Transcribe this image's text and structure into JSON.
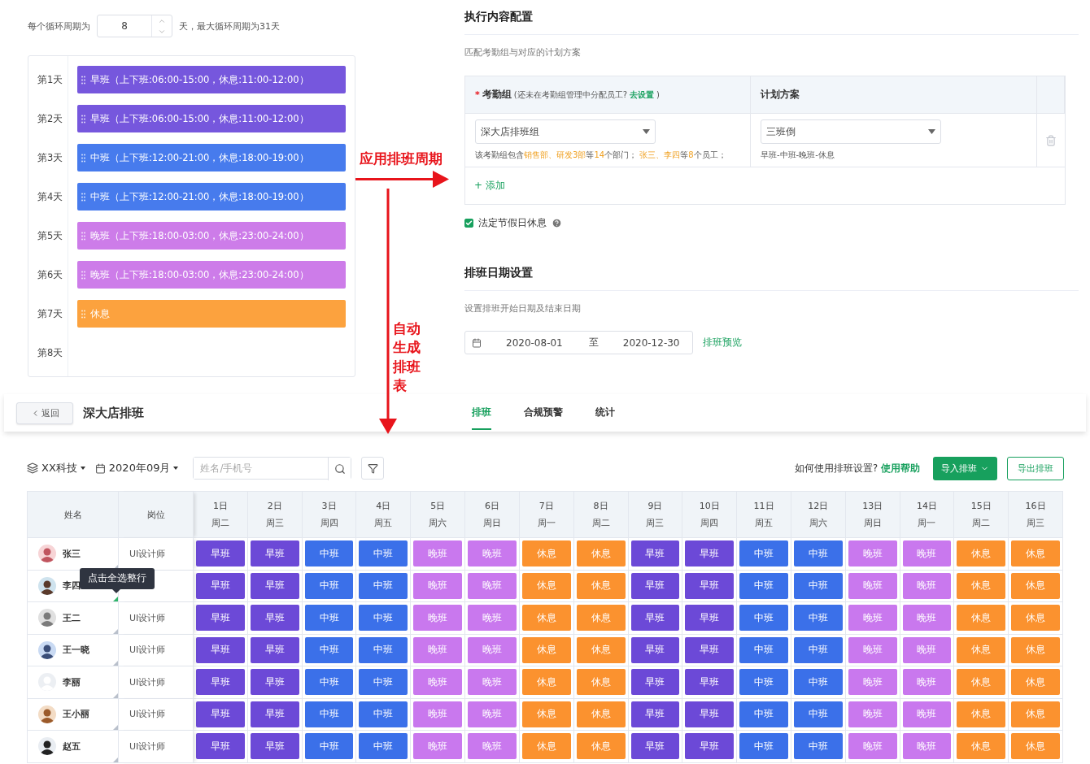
{
  "cycle": {
    "label": "每个循环周期为",
    "value": "8",
    "suffix": "天，最大循环周期为31天"
  },
  "cycle_days": [
    {
      "label": "第1天",
      "shift": {
        "kind": "early",
        "text": "早班（上下班:06:00-15:00，休息:11:00-12:00）"
      }
    },
    {
      "label": "第2天",
      "shift": {
        "kind": "early",
        "text": "早班（上下班:06:00-15:00，休息:11:00-12:00）"
      }
    },
    {
      "label": "第3天",
      "shift": {
        "kind": "mid",
        "text": "中班（上下班:12:00-21:00，休息:18:00-19:00）"
      }
    },
    {
      "label": "第4天",
      "shift": {
        "kind": "mid",
        "text": "中班（上下班:12:00-21:00，休息:18:00-19:00）"
      }
    },
    {
      "label": "第5天",
      "shift": {
        "kind": "late",
        "text": "晚班（上下班:18:00-03:00，休息:23:00-24:00）"
      }
    },
    {
      "label": "第6天",
      "shift": {
        "kind": "late",
        "text": "晚班（上下班:18:00-03:00，休息:23:00-24:00）"
      }
    },
    {
      "label": "第7天",
      "shift": {
        "kind": "rest",
        "text": "休息"
      }
    },
    {
      "label": "第8天"
    }
  ],
  "annotations": [
    {
      "kind": "horizontal",
      "text": "应用排班周期"
    },
    {
      "kind": "vertical",
      "text": "自动生成排班表"
    }
  ],
  "execution": {
    "title": "执行内容配置",
    "subtitle": "匹配考勤组与对应的计划方案",
    "group_header": {
      "required_mark": "*",
      "label": "考勤组",
      "hint": "(还未在考勤组管理中分配员工?",
      "link": "去设置",
      "hint_end": ")"
    },
    "plan_header": "计划方案",
    "rows": [
      {
        "group": "深大店排班组",
        "group_note": "该考勤组包含**销售部、研发3部**等**14**个部门；  **张三、李四**等**8**个员工；",
        "plan": "三班倒",
        "plan_note": "早班-中班-晚班-休息"
      }
    ],
    "add_link": "+ 添加",
    "holiday": {
      "label": "法定节假日休息",
      "checked": true
    }
  },
  "date_settings": {
    "title": "排班日期设置",
    "subtitle": "设置排班开始日期及结束日期",
    "start": "2020-08-01",
    "separator": "至",
    "end": "2020-12-30",
    "preview_link": "排班预览"
  },
  "header": {
    "back": "返回",
    "title": "深大店排班",
    "tabs": [
      {
        "label": "排班",
        "selected": true
      },
      {
        "label": "合规预警",
        "selected": false
      },
      {
        "label": "统计",
        "selected": false
      }
    ]
  },
  "toolbar": {
    "company": "XX科技",
    "month": "2020年09月",
    "search": {
      "placeholder": "姓名/手机号"
    },
    "help_text": "如何使用排班设置?",
    "help_link": "使用帮助",
    "import": "导入排班",
    "export": "导出排班"
  },
  "schedule": {
    "columns": {
      "name": "姓名",
      "role": "岗位"
    },
    "days": [
      {
        "date": "1日",
        "weekday": "周二"
      },
      {
        "date": "2日",
        "weekday": "周三"
      },
      {
        "date": "3日",
        "weekday": "周四"
      },
      {
        "date": "4日",
        "weekday": "周五"
      },
      {
        "date": "5日",
        "weekday": "周六"
      },
      {
        "date": "6日",
        "weekday": "周日"
      },
      {
        "date": "7日",
        "weekday": "周一"
      },
      {
        "date": "8日",
        "weekday": "周二"
      },
      {
        "date": "9日",
        "weekday": "周三"
      },
      {
        "date": "10日",
        "weekday": "周四"
      },
      {
        "date": "11日",
        "weekday": "周五"
      },
      {
        "date": "12日",
        "weekday": "周六"
      },
      {
        "date": "13日",
        "weekday": "周日"
      },
      {
        "date": "14日",
        "weekday": "周一"
      },
      {
        "date": "15日",
        "weekday": "周二"
      },
      {
        "date": "16日",
        "weekday": "周三"
      }
    ],
    "rows": [
      {
        "name": "张三",
        "role": "UI设计师",
        "selected": false,
        "shifts": [
          {
            "kind": "early",
            "text": "早班"
          },
          {
            "kind": "early",
            "text": "早班"
          },
          {
            "kind": "mid",
            "text": "中班"
          },
          {
            "kind": "mid",
            "text": "中班"
          },
          {
            "kind": "late",
            "text": "晚班"
          },
          {
            "kind": "late",
            "text": "晚班"
          },
          {
            "kind": "rest",
            "text": "休息"
          },
          {
            "kind": "rest",
            "text": "休息"
          },
          {
            "kind": "early",
            "text": "早班"
          },
          {
            "kind": "early",
            "text": "早班"
          },
          {
            "kind": "mid",
            "text": "中班"
          },
          {
            "kind": "mid",
            "text": "中班"
          },
          {
            "kind": "late",
            "text": "晚班"
          },
          {
            "kind": "late",
            "text": "晚班"
          },
          {
            "kind": "rest",
            "text": "休息"
          },
          {
            "kind": "rest",
            "text": "休息"
          }
        ]
      },
      {
        "name": "李四",
        "selected": true,
        "tooltip": "点击全选整行",
        "shifts": [
          {
            "kind": "early",
            "text": "早班"
          },
          {
            "kind": "early",
            "text": "早班"
          },
          {
            "kind": "mid",
            "text": "中班"
          },
          {
            "kind": "mid",
            "text": "中班"
          },
          {
            "kind": "late",
            "text": "晚班"
          },
          {
            "kind": "late",
            "text": "晚班"
          },
          {
            "kind": "rest",
            "text": "休息"
          },
          {
            "kind": "rest",
            "text": "休息"
          },
          {
            "kind": "early",
            "text": "早班"
          },
          {
            "kind": "early",
            "text": "早班"
          },
          {
            "kind": "mid",
            "text": "中班"
          },
          {
            "kind": "mid",
            "text": "中班"
          },
          {
            "kind": "late",
            "text": "晚班"
          },
          {
            "kind": "late",
            "text": "晚班"
          },
          {
            "kind": "rest",
            "text": "休息"
          },
          {
            "kind": "rest",
            "text": "休息"
          }
        ]
      },
      {
        "name": "王二",
        "role": "UI设计师",
        "selected": false,
        "shifts": [
          {
            "kind": "early",
            "text": "早班"
          },
          {
            "kind": "early",
            "text": "早班"
          },
          {
            "kind": "mid",
            "text": "中班"
          },
          {
            "kind": "mid",
            "text": "中班"
          },
          {
            "kind": "late",
            "text": "晚班"
          },
          {
            "kind": "late",
            "text": "晚班"
          },
          {
            "kind": "rest",
            "text": "休息"
          },
          {
            "kind": "rest",
            "text": "休息"
          },
          {
            "kind": "early",
            "text": "早班"
          },
          {
            "kind": "early",
            "text": "早班"
          },
          {
            "kind": "mid",
            "text": "中班"
          },
          {
            "kind": "mid",
            "text": "中班"
          },
          {
            "kind": "late",
            "text": "晚班"
          },
          {
            "kind": "late",
            "text": "晚班"
          },
          {
            "kind": "rest",
            "text": "休息"
          },
          {
            "kind": "rest",
            "text": "休息"
          }
        ]
      },
      {
        "name": "王一晓",
        "role": "UI设计师",
        "selected": false,
        "shifts": [
          {
            "kind": "early",
            "text": "早班"
          },
          {
            "kind": "early",
            "text": "早班"
          },
          {
            "kind": "mid",
            "text": "中班"
          },
          {
            "kind": "mid",
            "text": "中班"
          },
          {
            "kind": "late",
            "text": "晚班"
          },
          {
            "kind": "late",
            "text": "晚班"
          },
          {
            "kind": "rest",
            "text": "休息"
          },
          {
            "kind": "rest",
            "text": "休息"
          },
          {
            "kind": "early",
            "text": "早班"
          },
          {
            "kind": "early",
            "text": "早班"
          },
          {
            "kind": "mid",
            "text": "中班"
          },
          {
            "kind": "mid",
            "text": "中班"
          },
          {
            "kind": "late",
            "text": "晚班"
          },
          {
            "kind": "late",
            "text": "晚班"
          },
          {
            "kind": "rest",
            "text": "休息"
          },
          {
            "kind": "rest",
            "text": "休息"
          }
        ]
      },
      {
        "name": "李丽",
        "role": "UI设计师",
        "selected": false,
        "shifts": [
          {
            "kind": "early",
            "text": "早班"
          },
          {
            "kind": "early",
            "text": "早班"
          },
          {
            "kind": "mid",
            "text": "中班"
          },
          {
            "kind": "mid",
            "text": "中班"
          },
          {
            "kind": "late",
            "text": "晚班"
          },
          {
            "kind": "late",
            "text": "晚班"
          },
          {
            "kind": "rest",
            "text": "休息"
          },
          {
            "kind": "rest",
            "text": "休息"
          },
          {
            "kind": "early",
            "text": "早班"
          },
          {
            "kind": "early",
            "text": "早班"
          },
          {
            "kind": "mid",
            "text": "中班"
          },
          {
            "kind": "mid",
            "text": "中班"
          },
          {
            "kind": "late",
            "text": "晚班"
          },
          {
            "kind": "late",
            "text": "晚班"
          },
          {
            "kind": "rest",
            "text": "休息"
          },
          {
            "kind": "rest",
            "text": "休息"
          }
        ]
      },
      {
        "name": "王小丽",
        "role": "UI设计师",
        "selected": false,
        "shifts": [
          {
            "kind": "early",
            "text": "早班"
          },
          {
            "kind": "early",
            "text": "早班"
          },
          {
            "kind": "mid",
            "text": "中班"
          },
          {
            "kind": "mid",
            "text": "中班"
          },
          {
            "kind": "late",
            "text": "晚班"
          },
          {
            "kind": "late",
            "text": "晚班"
          },
          {
            "kind": "rest",
            "text": "休息"
          },
          {
            "kind": "rest",
            "text": "休息"
          },
          {
            "kind": "early",
            "text": "早班"
          },
          {
            "kind": "early",
            "text": "早班"
          },
          {
            "kind": "mid",
            "text": "中班"
          },
          {
            "kind": "mid",
            "text": "中班"
          },
          {
            "kind": "late",
            "text": "晚班"
          },
          {
            "kind": "late",
            "text": "晚班"
          },
          {
            "kind": "rest",
            "text": "休息"
          },
          {
            "kind": "rest",
            "text": "休息"
          }
        ]
      },
      {
        "name": "赵五",
        "role": "UI设计师",
        "selected": false,
        "shifts": [
          {
            "kind": "early",
            "text": "早班"
          },
          {
            "kind": "early",
            "text": "早班"
          },
          {
            "kind": "mid",
            "text": "中班"
          },
          {
            "kind": "mid",
            "text": "中班"
          },
          {
            "kind": "late",
            "text": "晚班"
          },
          {
            "kind": "late",
            "text": "晚班"
          },
          {
            "kind": "rest",
            "text": "休息"
          },
          {
            "kind": "rest",
            "text": "休息"
          },
          {
            "kind": "early",
            "text": "早班"
          },
          {
            "kind": "early",
            "text": "早班"
          },
          {
            "kind": "mid",
            "text": "中班"
          },
          {
            "kind": "mid",
            "text": "中班"
          },
          {
            "kind": "late",
            "text": "晚班"
          },
          {
            "kind": "late",
            "text": "晚班"
          },
          {
            "kind": "rest",
            "text": "休息"
          },
          {
            "kind": "rest",
            "text": "休息"
          }
        ]
      }
    ]
  }
}
